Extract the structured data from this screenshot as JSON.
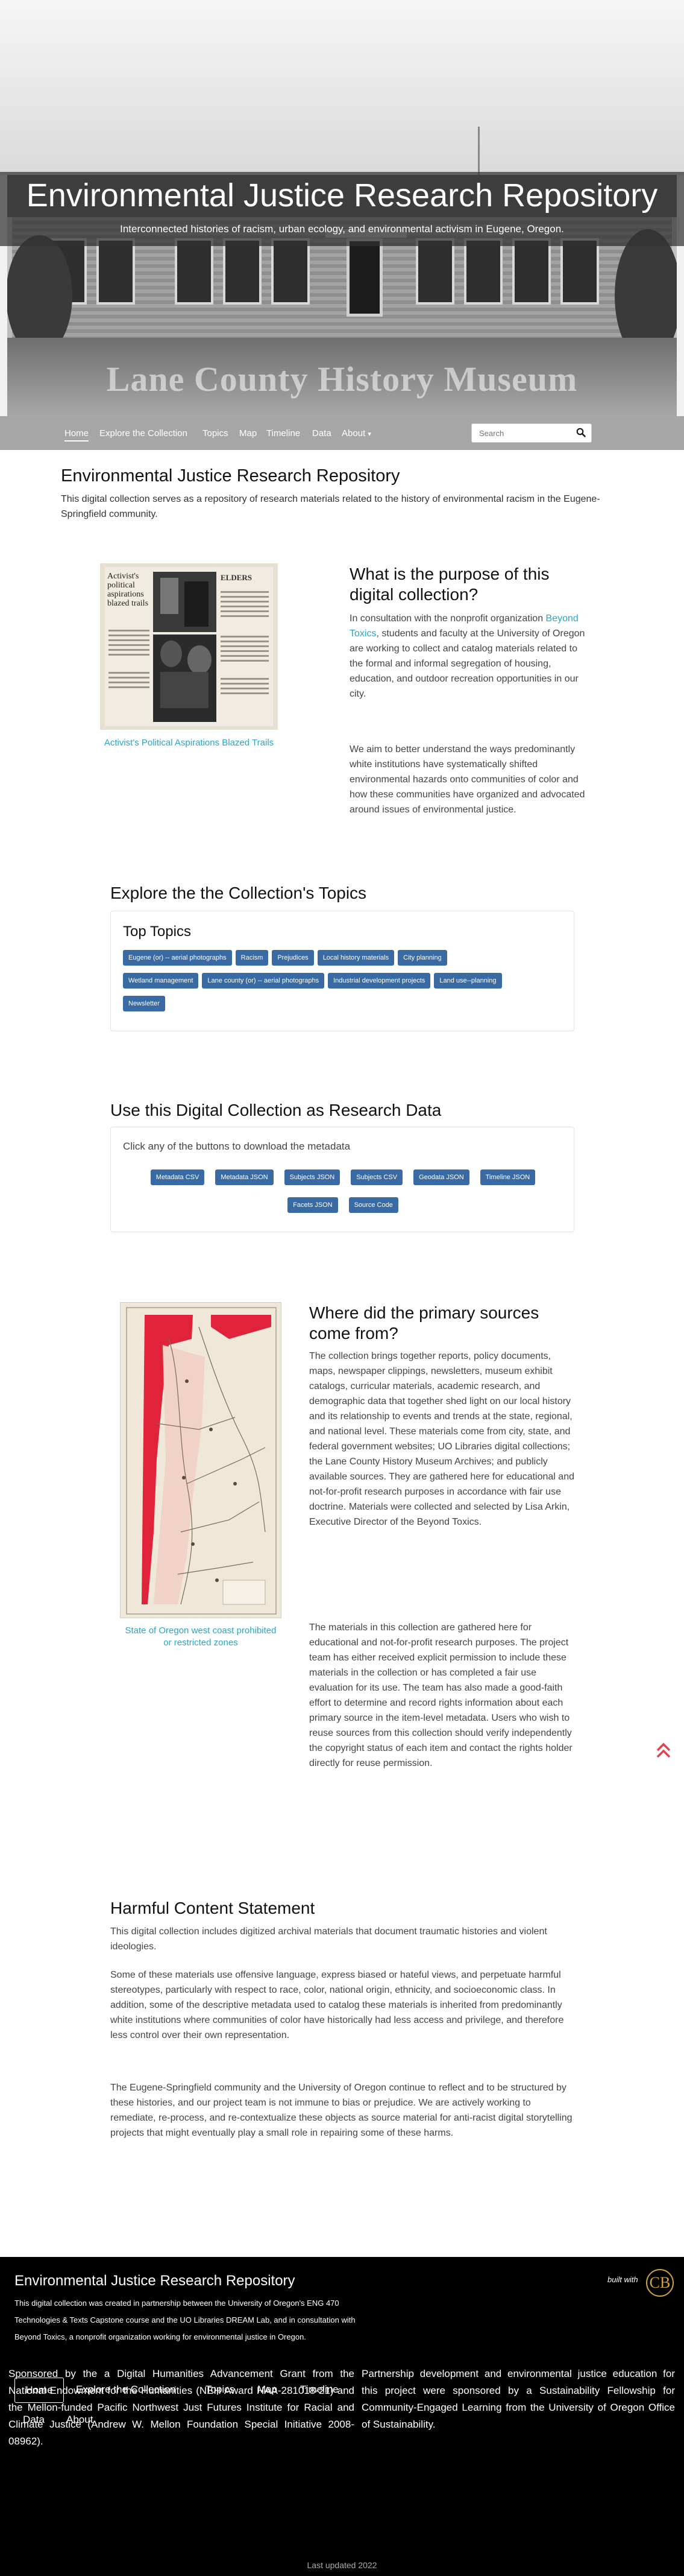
{
  "hero": {
    "title": "Environmental Justice Research Repository",
    "tagline": "Interconnected histories of racism, urban ecology, and environmental activism in Eugene, Oregon.",
    "watermark": "Lane County History Museum"
  },
  "nav": {
    "items": [
      {
        "label": "Home",
        "active": true
      },
      {
        "label": "Explore the Collection"
      },
      {
        "label": "Topics"
      },
      {
        "label": "Map"
      },
      {
        "label": "Timeline"
      },
      {
        "label": "Data"
      },
      {
        "label": "About",
        "dropdown": true
      }
    ],
    "about_caret": "▾",
    "search_placeholder": "Search",
    "search_icon": "search-icon"
  },
  "intro": {
    "heading": "Environmental Justice Research Repository",
    "text": "This digital collection serves as a repository of research materials related to the history of environmental racism in the Eugene-Springfield community."
  },
  "purpose": {
    "heading": "What is the purpose of this digital collection?",
    "p1_before": "In consultation with the nonprofit organization ",
    "p1_link": "Beyond Toxics",
    "p1_after": ", students and faculty at the University of Oregon are working to collect and catalog materials related to the formal and informal segregation of housing, education, and outdoor recreation opportunities in our city.",
    "p2": "We aim to better understand the ways predominantly white institutions have systematically shifted environmental hazards onto communities of color and how these communities have organized and advocated around issues of environmental justice.",
    "image_caption": "Activist's Political Aspirations Blazed Trails",
    "clip_headline": "Activist's political aspirations blazed trails",
    "clip_masthead": "ELDERS"
  },
  "topics": {
    "heading": "Explore the the Collection's Topics",
    "card_title": "Top Topics",
    "rows": [
      [
        "Eugene (or) -- aerial photographs",
        "Racism",
        "Prejudices",
        "Local history materials",
        "City planning"
      ],
      [
        "Wetland management",
        "Lane county (or) -- aerial photographs",
        "Industrial development projects",
        "Land use--planning"
      ],
      [
        "Newsletter"
      ]
    ]
  },
  "data": {
    "heading": "Use this Digital Collection as Research Data",
    "instruction": "Click any of the buttons to download the metadata",
    "row1": [
      "Metadata CSV",
      "Metadata JSON",
      "Subjects JSON",
      "Subjects CSV",
      "Geodata JSON",
      "Timeline JSON"
    ],
    "row2": [
      "Facets JSON",
      "Source Code"
    ]
  },
  "sources": {
    "heading": "Where did the primary sources come from?",
    "p1": "The collection brings together reports, policy documents, maps, newspaper clippings, newsletters, museum exhibit catalogs, curricular materials, academic research, and demographic data that together shed light on our local history and its relationship to events and trends at the state, regional, and national level. These materials come from city, state, and federal government websites; UO Libraries digital collections; the Lane County History Museum Archives; and publicly available sources. They are gathered here for educational and not-for-profit research purposes in accordance with fair use doctrine. Materials were collected and selected by Lisa Arkin, Executive Director of the Beyond Toxics.",
    "p2": "The materials in this collection are gathered here for educational and not-for-profit research purposes. The project team has either received explicit permission to include these materials in the collection or has completed a fair use evaluation for its use. The team has also made a good-faith effort to determine and record rights information about each primary source in the item-level metadata. Users who wish to reuse sources from this collection should verify independently the copyright status of each item and contact the rights holder directly for reuse permission.",
    "image_caption": "State of Oregon west coast prohibited or restricted zones"
  },
  "harmful": {
    "heading": "Harmful Content Statement",
    "p1": "This digital collection includes digitized archival materials that document traumatic histories and violent ideologies.",
    "p2": "Some of these materials use offensive language, express biased or hateful views, and perpetuate harmful stereotypes, particularly with respect to race, color, national origin, ethnicity, and socioeconomic class. In addition, some of the descriptive metadata used to catalog these materials is inherited from predominantly white institutions where communities of color have historically had less access and privilege, and therefore less control over their own representation.",
    "p3": "The Eugene-Springfield community and the University of Oregon continue to reflect and to be structured by these histories, and our project team is not immune to bias or prejudice. We are actively working to remediate, re-process, and re-contextualize these objects as source material for anti-racist digital storytelling projects that might eventually play a small role in repairing some of these harms."
  },
  "footer": {
    "title": "Environmental Justice Research Repository",
    "description": "This digital collection was created in partnership between the University of Oregon's ENG 470 Technologies & Texts Capstone course and the UO Libraries DREAM Lab, and in consultation with Beyond Toxics, a nonprofit organization working for environmental justice in Oregon.",
    "built_with": "built with",
    "logo_glyph": "CB",
    "nav": [
      "Home",
      "Explore the Collection",
      "Topics",
      "Map",
      "Timeline",
      "Data",
      "About"
    ],
    "sponsor_left": "Sponsored by the a Digital Humanities Advancement Grant from the National Endowment for the Humanities (NEH Award HAA-281018-21) and the Mellon-funded Pacific Northwest Just Futures Institute for Racial and Climate Justice (Andrew W. Mellon Foundation Special Initiative 2008-08962).",
    "sponsor_right": "Partnership development and environmental justice education for this project were sponsored by a Sustainability Fellowship for Community-Engaged Learning from the University of Oregon Office of Sustainability.",
    "copyright": "Last updated 2022"
  },
  "colors": {
    "accent_link": "#2aa5c8",
    "pill": "#3a6aa4",
    "navbar": "#a6a6a6",
    "totop": "#e0434b",
    "logo": "#c9a43a"
  }
}
